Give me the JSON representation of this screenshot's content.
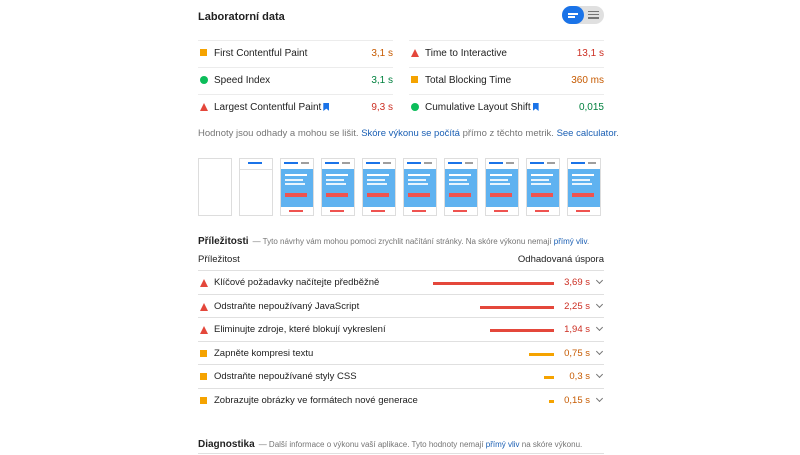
{
  "lab": {
    "title": "Laboratorní data",
    "view_toggle": {
      "left_icon": "bars-icon",
      "right_icon": "list-icon",
      "accent": "#1a73e8"
    }
  },
  "metrics": [
    {
      "label": "First Contentful Paint",
      "value": "3,1 s",
      "status": "average",
      "icon": "square-icon",
      "info": false
    },
    {
      "label": "Time to Interactive",
      "value": "13,1 s",
      "status": "fail",
      "icon": "triangle-icon",
      "info": false
    },
    {
      "label": "Speed Index",
      "value": "3,1 s",
      "status": "pass",
      "icon": "circle-icon",
      "info": false
    },
    {
      "label": "Total Blocking Time",
      "value": "360 ms",
      "status": "average",
      "icon": "square-icon",
      "info": false
    },
    {
      "label": "Largest Contentful Paint",
      "value": "9,3 s",
      "status": "fail",
      "icon": "triangle-icon",
      "info": true
    },
    {
      "label": "Cumulative Layout Shift",
      "value": "0,015",
      "status": "pass",
      "icon": "circle-icon",
      "info": true
    }
  ],
  "note": {
    "prefix": "Hodnoty jsou odhady a mohou se lišit. ",
    "link1": "Skóre výkonu se počítá",
    "middle": " přímo z těchto metrik. ",
    "link2": "See calculator",
    "suffix": "."
  },
  "filmstrip": {
    "frames": 10
  },
  "opportunities": {
    "title": "Příležitosti",
    "desc_prefix": "— Tyto návrhy vám mohou pomoci zrychlit načítání stránky. Na skóre výkonu nemají ",
    "desc_link": "přímý vliv",
    "desc_suffix": ".",
    "col_left": "Příležitost",
    "col_right": "Odhadovaná úspora",
    "items": [
      {
        "label": "Klíčové požadavky načítejte předběžně",
        "value": "3,69 s",
        "savings_s": 3.69,
        "status": "fail"
      },
      {
        "label": "Odstraňte nepoužívaný JavaScript",
        "value": "2,25 s",
        "savings_s": 2.25,
        "status": "fail"
      },
      {
        "label": "Eliminujte zdroje, které blokují vykreslení",
        "value": "1,94 s",
        "savings_s": 1.94,
        "status": "fail"
      },
      {
        "label": "Zapněte kompresi textu",
        "value": "0,75 s",
        "savings_s": 0.75,
        "status": "average"
      },
      {
        "label": "Odstraňte nepoužívané styly CSS",
        "value": "0,3 s",
        "savings_s": 0.3,
        "status": "average"
      },
      {
        "label": "Zobrazujte obrázky ve formátech nové generace",
        "value": "0,15 s",
        "savings_s": 0.15,
        "status": "average"
      }
    ]
  },
  "diagnostics": {
    "title": "Diagnostika",
    "desc_prefix": "— Další informace o výkonu vaší aplikace. Tyto hodnoty nemají ",
    "desc_link": "přímý vliv",
    "desc_suffix": " na skóre výkonu."
  },
  "colors": {
    "fail": "#e4473b",
    "average": "#f5a300",
    "pass": "#0cbd5a",
    "link": "#1a5fb4"
  }
}
